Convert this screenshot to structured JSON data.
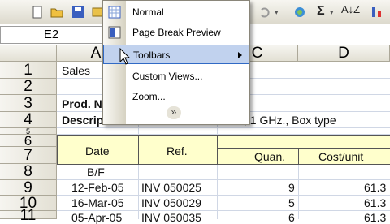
{
  "namebox": {
    "value": "E2"
  },
  "toolbar": {
    "sigma": "Σ",
    "sort_label": "A↓Z"
  },
  "columns": {
    "a": "A",
    "c": "C",
    "d": "D"
  },
  "rows": [
    "1",
    "2",
    "3",
    "4",
    "5",
    "6",
    "7",
    "8",
    "9",
    "10",
    "11"
  ],
  "cells": {
    "a1": "Sales",
    "a3": "Prod. N",
    "a4": "Descrip",
    "c4": ", 1 GHz., Box type",
    "date_hdr": "Date",
    "ref_hdr": "Ref.",
    "quan_hdr": "Quan.",
    "cost_hdr": "Cost/unit",
    "bf": "B/F",
    "r9_date": "12-Feb-05",
    "r9_ref": "INV 050025",
    "r9_q": "9",
    "r9_c": "61.3",
    "r10_date": "16-Mar-05",
    "r10_ref": "INV 050029",
    "r10_q": "5",
    "r10_c": "61.3",
    "r11_date": "05-Apr-05",
    "r11_ref": "INV 050035",
    "r11_q": "6",
    "r11_c": "61.3"
  },
  "menu": {
    "items": [
      {
        "label": "Normal"
      },
      {
        "label": "Page Break Preview"
      },
      {
        "label": "Toolbars"
      },
      {
        "label": "Custom Views..."
      },
      {
        "label": "Zoom..."
      }
    ],
    "expand": "»"
  }
}
